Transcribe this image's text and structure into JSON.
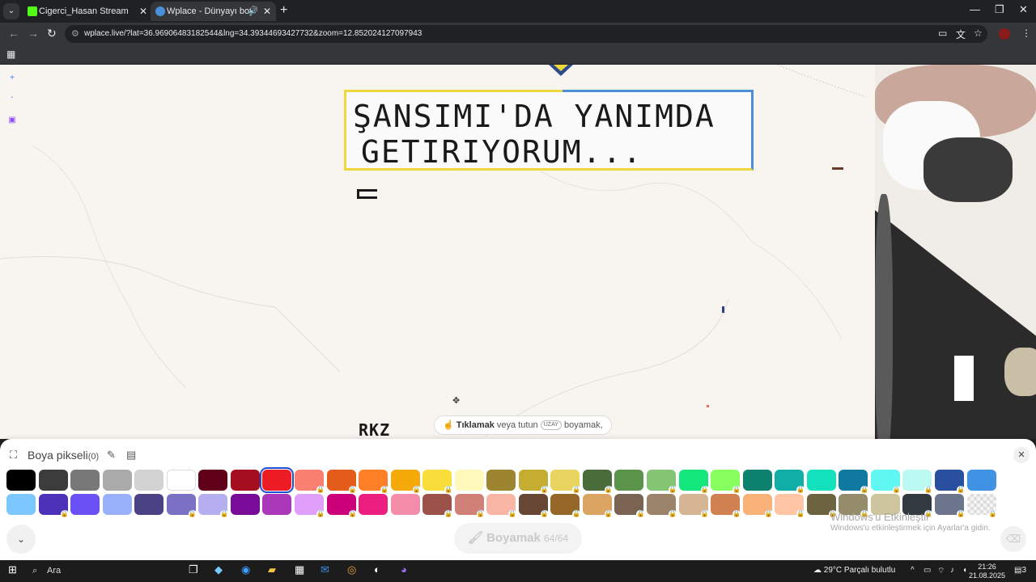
{
  "browser": {
    "tabs": [
      {
        "title": "Cigerci_Hasan Stream - Watch L",
        "favicon": "kick-icon",
        "color": "#53fc18"
      },
      {
        "title": "Wplace - Dünyayı boya",
        "favicon": "globe-icon",
        "color": "#4a90d9"
      }
    ],
    "url": "wplace.live/?lat=36.96906483182544&lng=34.39344693427732&zoom=12.852024127097943",
    "new_tab_label": "+",
    "minimize": "—",
    "restore": "❐",
    "close": "✕"
  },
  "map": {
    "zoom_in": "+",
    "zoom_out": "-",
    "banner_line1": "ŞANSIMI'DA YANIMDA",
    "banner_line2": "GETIRIYORUM...",
    "rkz_text": "RKZ",
    "hint_bold": "Tıklamak",
    "hint_mid": "veya tutun",
    "hint_key": "UZAY",
    "hint_end": "boyamak,"
  },
  "panel": {
    "title": "Boya pikseli",
    "count": "(0)",
    "paint_label": "Boyamak",
    "paint_count": "64/64",
    "activate_title": "Windows'u Etkinleştir",
    "activate_text": "Windows'u etkinleştirmek için Ayarlar'a gidin.",
    "colors_row1": [
      "#000000",
      "#3c3c3c",
      "#787878",
      "#aaaaaa",
      "#d2d2d2",
      "#ffffff",
      "#600018",
      "#a50e1e",
      "#ed1c24",
      "#fa8072",
      "#e45c1a",
      "#ff7f27",
      "#f6aa09",
      "#f9dd3b",
      "#fffabc",
      "#9c8431",
      "#c5ad31",
      "#e8d45f",
      "#4a6b3a",
      "#5a944a",
      "#84c573",
      "#13e67b",
      "#87ff5e",
      "#0c816e",
      "#10aea6",
      "#13e1be",
      "#0f799f",
      "#60f7f2",
      "#bbfaf2",
      "#28509e",
      "#4093e4"
    ],
    "colors_row2": [
      "#7dc7ff",
      "#4d31b8",
      "#6b50f6",
      "#99b1fb",
      "#4a4284",
      "#7a71c4",
      "#b5aef1",
      "#780c99",
      "#aa38b9",
      "#e09ff9",
      "#cb007a",
      "#ec1f80",
      "#f38da9",
      "#9b5249",
      "#d18078",
      "#fab6a4",
      "#684634",
      "#95682a",
      "#dba463",
      "#7b6352",
      "#9c846b",
      "#d6b594",
      "#d18051",
      "#f8b277",
      "#ffc5a5",
      "#6d643f",
      "#948c6b",
      "#cdc59e",
      "#333941",
      "#6d758d",
      "#b3b9d1"
    ],
    "selected_index": 8,
    "locked_row1": [
      9,
      10,
      11,
      12,
      13,
      16,
      17,
      18,
      20,
      21,
      22,
      24,
      26,
      27,
      28,
      29
    ],
    "locked_row2": [
      1,
      5,
      6,
      9,
      10,
      13,
      14,
      15,
      16,
      17,
      18,
      19,
      20,
      21,
      22,
      23,
      24,
      25,
      26,
      28,
      29,
      30
    ]
  },
  "taskbar": {
    "search": "Ara",
    "weather": "29°C  Parçalı bulutlu",
    "time": "21:26",
    "date": "21.08.2025",
    "notif": "3"
  }
}
